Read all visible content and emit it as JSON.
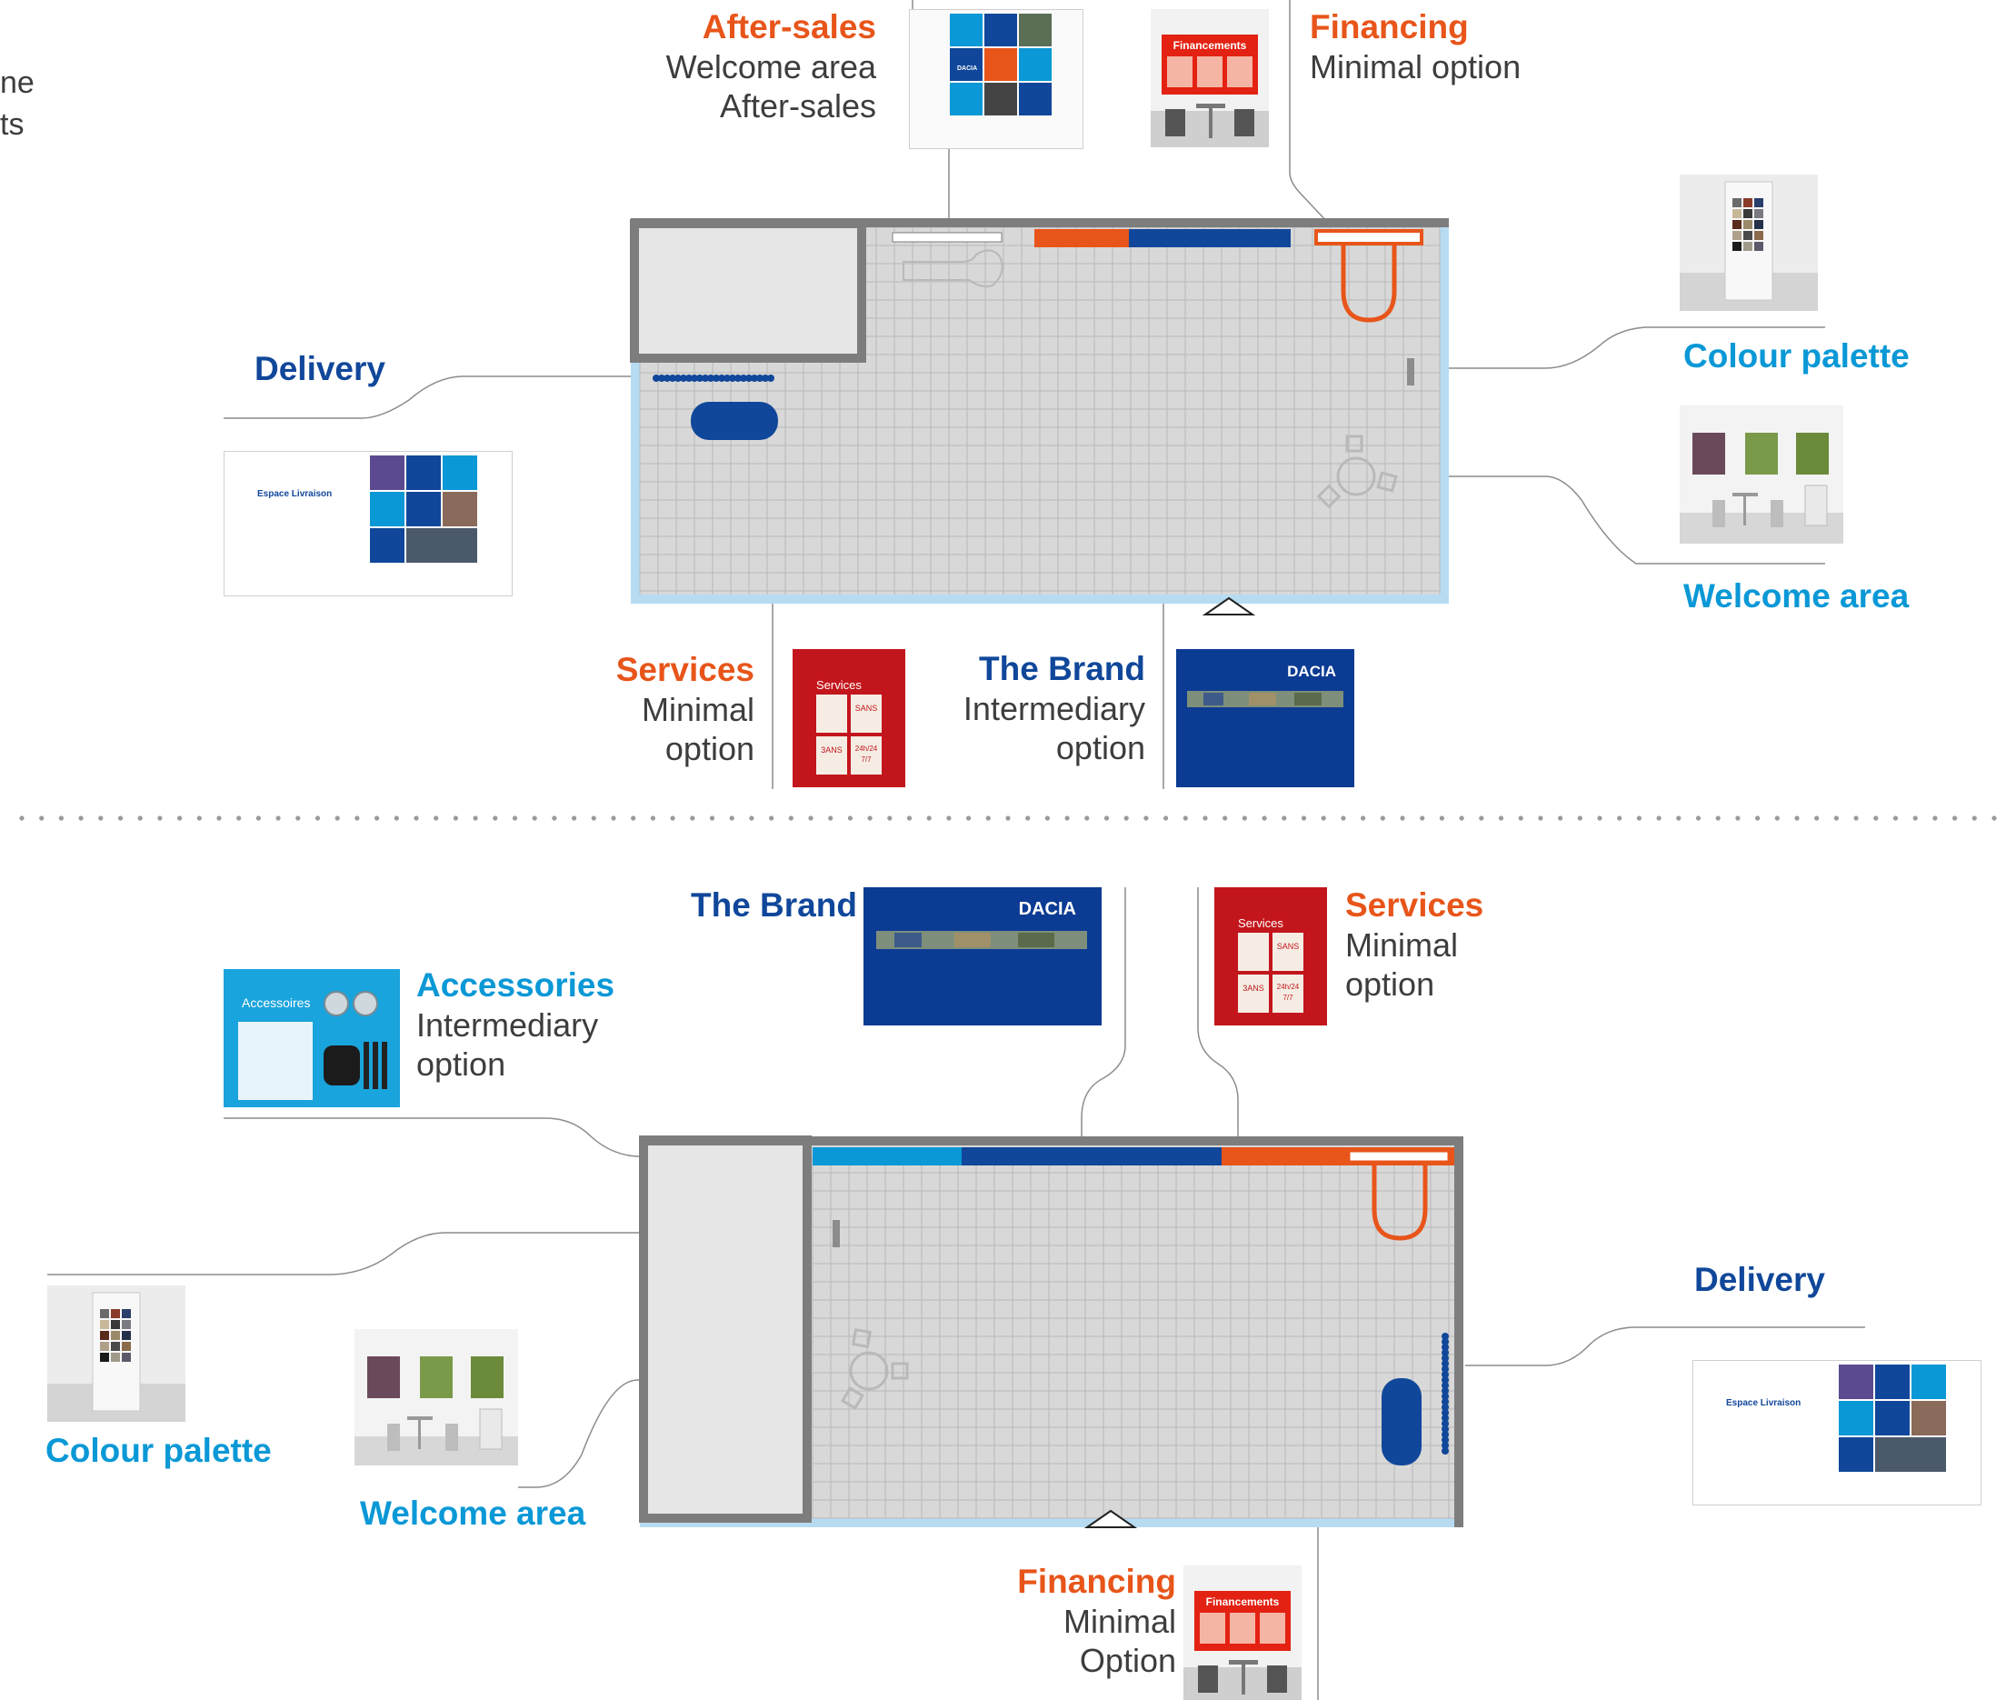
{
  "colors": {
    "orange": "#E8551A",
    "navy": "#10479A",
    "cyan": "#0A98D6",
    "grid": "#b9b9b9",
    "floor": "#d8d8d8",
    "wall": "#7d7d7d",
    "light_blue": "#b7dcf2",
    "line": "#8c8c8c",
    "dots": "#9a9a9a"
  },
  "corner_text": [
    "ne",
    "ts"
  ],
  "layout_1": {
    "after_sales": {
      "title": "After-sales",
      "lines": [
        "Welcome area",
        "After-sales"
      ]
    },
    "financing": {
      "title": "Financing",
      "lines": [
        "Minimal option"
      ]
    },
    "colour_palette": {
      "title": "Colour palette"
    },
    "welcome_area": {
      "title": "Welcome area"
    },
    "delivery": {
      "title": "Delivery"
    },
    "services": {
      "title": "Services",
      "lines": [
        "Minimal",
        "option"
      ]
    },
    "the_brand": {
      "title": "The Brand",
      "lines": [
        "Intermediary",
        "option"
      ]
    }
  },
  "layout_2": {
    "the_brand": {
      "title": "The Brand"
    },
    "services": {
      "title": "Services",
      "lines": [
        "Minimal",
        "option"
      ]
    },
    "accessories": {
      "title": "Accessories",
      "lines": [
        "Intermediary",
        "option"
      ]
    },
    "colour_palette": {
      "title": "Colour palette"
    },
    "welcome_area": {
      "title": "Welcome area"
    },
    "delivery": {
      "title": "Delivery"
    },
    "financing": {
      "title": "Financing",
      "lines": [
        "Minimal",
        "Option"
      ]
    }
  },
  "thumbnail_text": {
    "financements": "Financements",
    "services": "Services",
    "dacia": "DACIA",
    "espace_livraison": "Espace Livraison",
    "accessoires": "Accessoires",
    "sans": "SANS",
    "ans": "3ANS",
    "hours": "24h/24",
    "days": "7/7"
  }
}
